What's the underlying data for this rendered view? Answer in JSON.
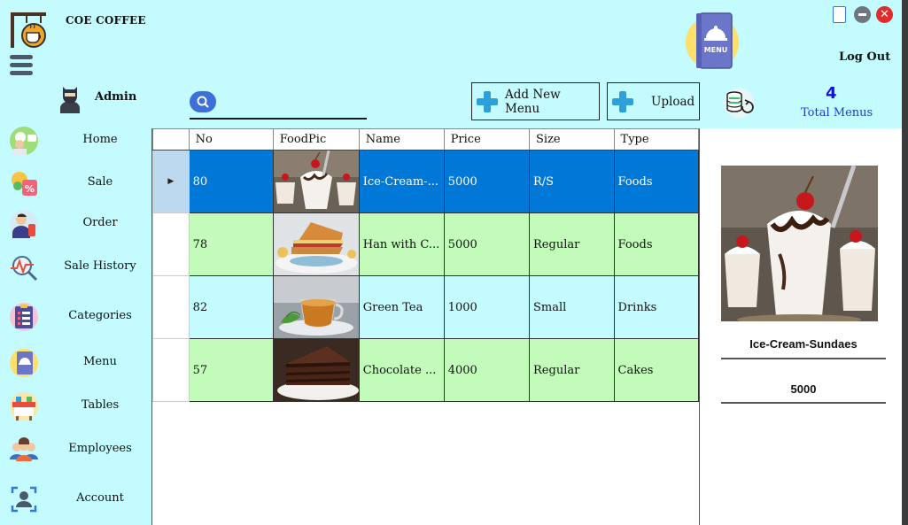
{
  "app": {
    "title": "COE COFFEE",
    "logout_label": "Log Out"
  },
  "user": {
    "name": "Admin"
  },
  "toolbar": {
    "add_menu_label": "Add New Menu",
    "upload_label": "Upload"
  },
  "stats": {
    "total_count": "4",
    "total_label": "Total Menus"
  },
  "menu_badge": "MENU",
  "sidebar": {
    "items": [
      {
        "label": "Home",
        "icon": "chef-icon"
      },
      {
        "label": "Sale",
        "icon": "discount-icon"
      },
      {
        "label": "Order",
        "icon": "waiter-icon"
      },
      {
        "label": "Sale History",
        "icon": "chart-search-icon"
      },
      {
        "label": "Categories",
        "icon": "list-icon"
      },
      {
        "label": "Menu",
        "icon": "menu-book-icon"
      },
      {
        "label": "Tables",
        "icon": "table-icon"
      },
      {
        "label": "Employees",
        "icon": "people-icon"
      },
      {
        "label": "Account",
        "icon": "account-icon"
      }
    ]
  },
  "table": {
    "columns": [
      "No",
      "FoodPic",
      "Name",
      "Price",
      "Size",
      "Type"
    ],
    "rows": [
      {
        "no": "80",
        "name": "Ice-Cream-...",
        "price": "5000",
        "size": "R/S",
        "type": "Foods",
        "pic": "ice-cream-image"
      },
      {
        "no": "78",
        "name": "Han with C...",
        "price": "5000",
        "size": "Regular",
        "type": "Foods",
        "pic": "sandwich-image"
      },
      {
        "no": "82",
        "name": "Green Tea",
        "price": "1000",
        "size": "Small",
        "type": "Drinks",
        "pic": "tea-image"
      },
      {
        "no": "57",
        "name": "Chocolate ...",
        "price": "4000",
        "size": "Regular",
        "type": "Cakes",
        "pic": "cake-image"
      }
    ]
  },
  "detail": {
    "name": "Ice-Cream-Sundaes",
    "price": "5000"
  },
  "colors": {
    "background": "#c3fbfe",
    "selected": "#0078d7",
    "green_row": "#c3fbbb",
    "accent_blue": "#1010dd"
  }
}
